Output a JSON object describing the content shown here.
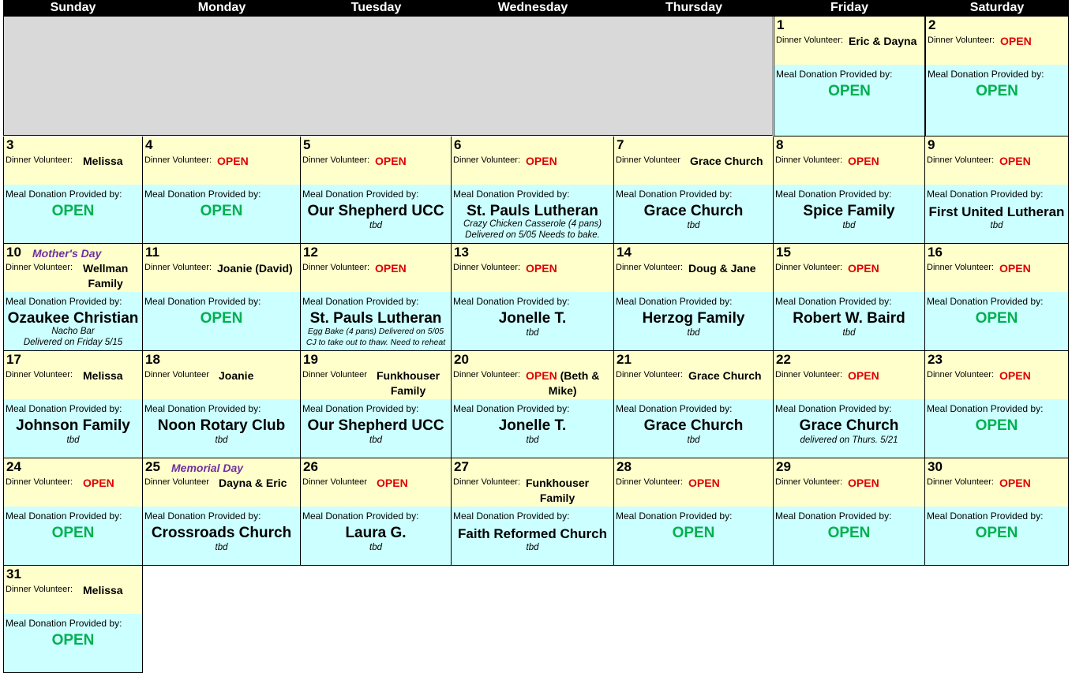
{
  "weekdays": [
    "Sunday",
    "Monday",
    "Tuesday",
    "Wednesday",
    "Thursday",
    "Friday",
    "Saturday"
  ],
  "labels": {
    "dinner_volunteer": "Dinner Volunteer:",
    "dinner_volunteer_alt": "Dinner Volunteer",
    "meal_donation": "Meal Donation Provided by:"
  },
  "colors": {
    "header_bg": "#000000",
    "volunteer_bg": "#ffffcc",
    "meal_bg": "#ccffff",
    "open_red": "#e00000",
    "open_green": "#00b050",
    "holiday_purple": "#7030a0",
    "empty_gray": "#d9d9d9"
  },
  "days": [
    {
      "day": "1",
      "volunteer": "Eric & Dayna",
      "volunteer_open": false,
      "meal": "OPEN",
      "meal_open": true,
      "note": ""
    },
    {
      "day": "2",
      "volunteer": "OPEN",
      "volunteer_open": true,
      "meal": "OPEN",
      "meal_open": true,
      "note": ""
    },
    {
      "day": "3",
      "volunteer": "Melissa",
      "volunteer_open": false,
      "meal": "OPEN",
      "meal_open": true,
      "note": ""
    },
    {
      "day": "4",
      "volunteer": "OPEN",
      "volunteer_open": true,
      "meal": "OPEN",
      "meal_open": true,
      "note": ""
    },
    {
      "day": "5",
      "volunteer": "OPEN",
      "volunteer_open": true,
      "meal": "Our Shepherd UCC",
      "meal_open": false,
      "note": "tbd"
    },
    {
      "day": "6",
      "volunteer": "OPEN",
      "volunteer_open": true,
      "meal": "St. Pauls Lutheran",
      "meal_open": false,
      "note": "Crazy Chicken Casserole (4 pans)\nDelivered on 5/05 Needs to bake."
    },
    {
      "day": "7",
      "volunteer": "Grace Church",
      "volunteer_open": false,
      "label_alt": true,
      "meal": "Grace Church",
      "meal_open": false,
      "note": "tbd"
    },
    {
      "day": "8",
      "volunteer": "OPEN",
      "volunteer_open": true,
      "meal": "Spice Family",
      "meal_open": false,
      "note": "tbd"
    },
    {
      "day": "9",
      "volunteer": "OPEN",
      "volunteer_open": true,
      "meal": "First United Lutheran",
      "meal_open": false,
      "meal_small": true,
      "note": "tbd"
    },
    {
      "day": "10",
      "holiday": "Mother's Day",
      "volunteer": "Wellman\nFamily",
      "volunteer_open": false,
      "meal": "Ozaukee Christian",
      "meal_open": false,
      "note": "Nacho Bar\nDelivered on Friday 5/15"
    },
    {
      "day": "11",
      "volunteer": "Joanie (David)",
      "volunteer_open": false,
      "meal": "OPEN",
      "meal_open": true,
      "note": ""
    },
    {
      "day": "12",
      "volunteer": "OPEN",
      "volunteer_open": true,
      "meal": "St. Pauls Lutheran",
      "meal_open": false,
      "note": "Egg Bake (4 pans) Delivered on 5/05\nCJ to take out to thaw. Need to reheat",
      "note_small": true
    },
    {
      "day": "13",
      "volunteer": "OPEN",
      "volunteer_open": true,
      "meal": "Jonelle T.",
      "meal_open": false,
      "note": "tbd"
    },
    {
      "day": "14",
      "volunteer": "Doug & Jane",
      "volunteer_open": false,
      "meal": "Herzog Family",
      "meal_open": false,
      "note": "tbd"
    },
    {
      "day": "15",
      "volunteer": "OPEN",
      "volunteer_open": true,
      "meal": "Robert W. Baird",
      "meal_open": false,
      "note": "tbd"
    },
    {
      "day": "16",
      "volunteer": "OPEN",
      "volunteer_open": true,
      "meal": "OPEN",
      "meal_open": true,
      "note": ""
    },
    {
      "day": "17",
      "volunteer": "Melissa",
      "volunteer_open": false,
      "meal": "Johnson Family",
      "meal_open": false,
      "note": "tbd"
    },
    {
      "day": "18",
      "volunteer": "Joanie",
      "volunteer_open": false,
      "label_alt": true,
      "meal": "Noon Rotary Club",
      "meal_open": false,
      "note": "tbd"
    },
    {
      "day": "19",
      "volunteer": "Funkhouser\nFamily",
      "volunteer_open": false,
      "label_alt": true,
      "meal": "Our Shepherd UCC",
      "meal_open": false,
      "note": "tbd"
    },
    {
      "day": "20",
      "volunteer": "OPEN",
      "volunteer_open": true,
      "volunteer_extra": " (Beth &\nMike)",
      "meal": "Jonelle T.",
      "meal_open": false,
      "note": "tbd"
    },
    {
      "day": "21",
      "volunteer": "Grace Church",
      "volunteer_open": false,
      "meal": "Grace Church",
      "meal_open": false,
      "note": "tbd"
    },
    {
      "day": "22",
      "volunteer": "OPEN",
      "volunteer_open": true,
      "meal": "Grace Church",
      "meal_open": false,
      "note": "delivered on Thurs. 5/21"
    },
    {
      "day": "23",
      "volunteer": "OPEN",
      "volunteer_open": true,
      "meal": "OPEN",
      "meal_open": true,
      "note": ""
    },
    {
      "day": "24",
      "volunteer": "OPEN",
      "volunteer_open": true,
      "meal": "OPEN",
      "meal_open": true,
      "note": ""
    },
    {
      "day": "25",
      "holiday": "Memorial Day",
      "volunteer": "Dayna & Eric",
      "volunteer_open": false,
      "label_alt": true,
      "meal": "Crossroads Church",
      "meal_open": false,
      "note": "tbd"
    },
    {
      "day": "26",
      "volunteer": "OPEN",
      "volunteer_open": true,
      "label_alt": true,
      "meal": "Laura G.",
      "meal_open": false,
      "note": "tbd"
    },
    {
      "day": "27",
      "volunteer": "Funkhouser\nFamily",
      "volunteer_open": false,
      "meal": "Faith Reformed Church",
      "meal_open": false,
      "meal_small": true,
      "note": "tbd"
    },
    {
      "day": "28",
      "volunteer": "OPEN",
      "volunteer_open": true,
      "meal": "OPEN",
      "meal_open": true,
      "note": ""
    },
    {
      "day": "29",
      "volunteer": "OPEN",
      "volunteer_open": true,
      "meal": "OPEN",
      "meal_open": true,
      "note": ""
    },
    {
      "day": "30",
      "volunteer": "OPEN",
      "volunteer_open": true,
      "meal": "OPEN",
      "meal_open": true,
      "note": ""
    },
    {
      "day": "31",
      "volunteer": "Melissa",
      "volunteer_open": false,
      "meal": "OPEN",
      "meal_open": true,
      "note": ""
    }
  ]
}
